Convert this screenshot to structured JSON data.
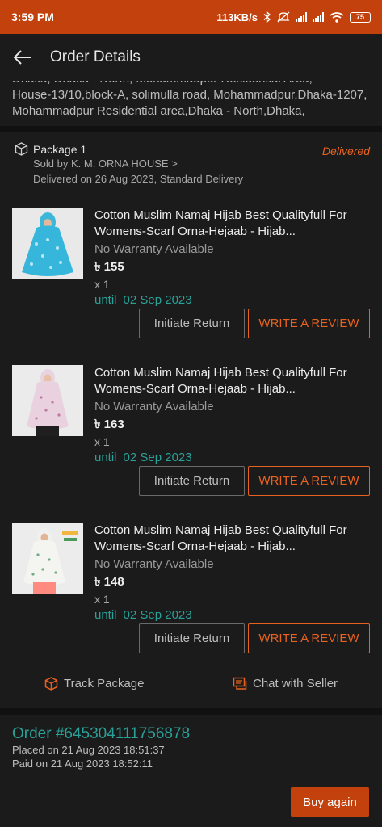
{
  "status_bar": {
    "time": "3:59 PM",
    "net_speed": "113KB/s",
    "battery": "75"
  },
  "app_bar": {
    "title": "Order Details"
  },
  "address": {
    "line1": "Dhaka, Dhaka - North, Mohammadpur Residential Area,",
    "line2": "House-13/10,block-A, solimulla road, Mohammadpur,Dhaka-1207, Mohammadpur Residential area,Dhaka - North,Dhaka,"
  },
  "package": {
    "title": "Package 1",
    "status": "Delivered",
    "seller": "Sold by K. M. ORNA HOUSE >",
    "delivery": "Delivered on 26 Aug 2023, Standard Delivery"
  },
  "items": [
    {
      "name": "Cotton Muslim Namaj Hijab Best Qualityfull For Womens-Scarf Orna-Hejaab - Hijab...",
      "warranty": "No Warranty Available",
      "price": "৳ 155",
      "qty": "x 1",
      "until_label": "until",
      "until_date": "02 Sep 2023",
      "return_label": "Initiate Return",
      "review_label": "WRITE A REVIEW"
    },
    {
      "name": "Cotton Muslim Namaj Hijab Best Qualityfull For Womens-Scarf Orna-Hejaab - Hijab...",
      "warranty": "No Warranty Available",
      "price": "৳ 163",
      "qty": "x 1",
      "until_label": "until",
      "until_date": "02 Sep 2023",
      "return_label": "Initiate Return",
      "review_label": "WRITE A REVIEW"
    },
    {
      "name": "Cotton Muslim Namaj Hijab Best Qualityfull For Womens-Scarf Orna-Hejaab - Hijab...",
      "warranty": "No Warranty Available",
      "price": "৳ 148",
      "qty": "x 1",
      "until_label": "until",
      "until_date": "02 Sep 2023",
      "return_label": "Initiate Return",
      "review_label": "WRITE A REVIEW"
    }
  ],
  "actions": {
    "track": "Track Package",
    "chat": "Chat with Seller"
  },
  "order": {
    "number": "Order #645304111756878",
    "placed": "Placed on 21 Aug 2023  18:51:37",
    "paid": "Paid on 21 Aug 2023  18:52:11",
    "buy_again": "Buy again"
  },
  "colors": {
    "accent": "#c2410c",
    "status_orange": "#e8621f",
    "teal": "#2aa198",
    "background": "#1b1b1b"
  }
}
